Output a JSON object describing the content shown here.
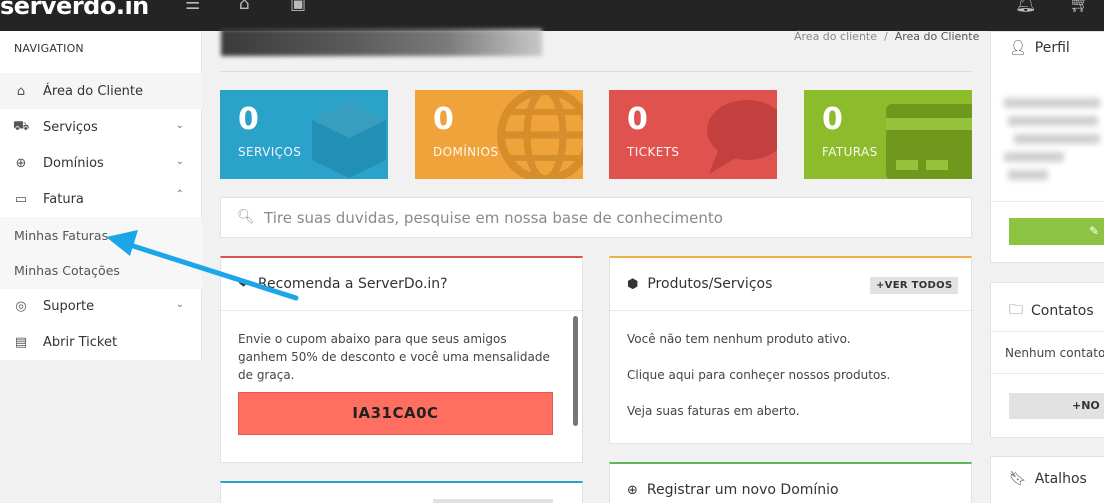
{
  "topbar": {
    "logo_main": "server",
    "logo_accent": "do.in",
    "menu_icon": "hamburger-icon",
    "home_icon": "home-icon",
    "image_icon": "image-icon",
    "bell_icon": "bell-icon",
    "cart_icon": "cart-icon"
  },
  "sidebar": {
    "heading": "NAVIGATION",
    "items": [
      {
        "label": "Área do Cliente",
        "icon": "home-icon"
      },
      {
        "label": "Serviços",
        "icon": "basket-icon"
      },
      {
        "label": "Domínios",
        "icon": "globe-icon"
      },
      {
        "label": "Fatura",
        "icon": "credit-card-icon"
      },
      {
        "label": "Suporte",
        "icon": "lifebuoy-icon"
      },
      {
        "label": "Abrir Ticket",
        "icon": "ticket-icon"
      }
    ],
    "subitems": [
      "Minhas Faturas",
      "Minhas Cotações"
    ]
  },
  "breadcrumb": {
    "parent": "Área do cliente",
    "separator": "/",
    "current": "Área do Cliente"
  },
  "tiles": [
    {
      "value": "0",
      "label": "SERVIÇOS",
      "color": "#2aa2c9"
    },
    {
      "value": "0",
      "label": "DOMÍNIOS",
      "color": "#f0a33a"
    },
    {
      "value": "0",
      "label": "TICKETS",
      "color": "#e0524e"
    },
    {
      "value": "0",
      "label": "FATURAS",
      "color": "#8cbb2c"
    }
  ],
  "search": {
    "placeholder": "Tire suas duvidas, pesquise em nossa base de conhecimento"
  },
  "recommend": {
    "title": "Recomenda a ServerDo.in?",
    "text": "Envie o cupom abaixo para que seus amigos ganhem 50% de desconto e você uma mensalidade de graça.",
    "coupon": "IA31CA0C"
  },
  "products": {
    "title": "Produtos/Serviços",
    "view_all": "+VER TODOS",
    "empty": "Você não tem nenhum produto ativo.",
    "link1": "Clique aqui para conheçer nossos produtos.",
    "link2": "Veja suas faturas em aberto."
  },
  "register_domain": {
    "title": "Registrar um novo Domínio"
  },
  "right": {
    "profile_title": "Perfil",
    "contacts_title": "Contatos",
    "contacts_empty": "Nenhum contato",
    "contacts_btn": "+NO",
    "bookmarks_title": "Atalhos"
  },
  "colors": {
    "accent_orange": "#e8761b",
    "arrow": "#1ba6e8"
  }
}
